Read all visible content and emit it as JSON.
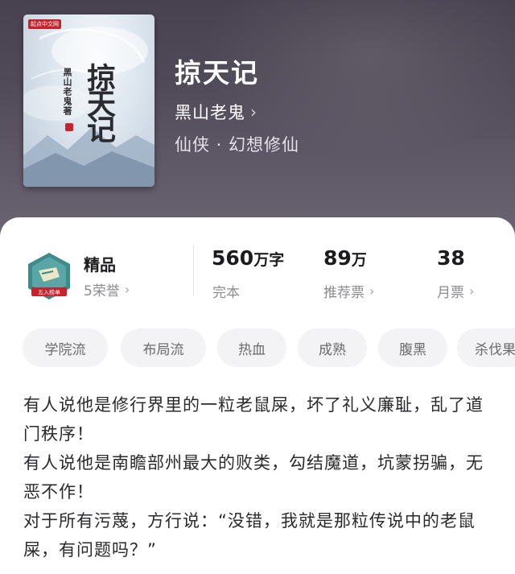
{
  "book": {
    "title": "掠天记",
    "author": "黑山老鬼",
    "genre": "仙侠 · 幻想修仙",
    "cover": {
      "publisher": "起点中文网",
      "title": "掠天记",
      "author": "黑山老鬼著"
    }
  },
  "stats": {
    "quality": {
      "label": "精品",
      "honors": "5荣誉"
    },
    "badge_text": "五入榜单",
    "words": {
      "value": "560",
      "unit": "万字",
      "label": "完本"
    },
    "recommend": {
      "value": "89",
      "unit": "万",
      "label": "推荐票"
    },
    "monthly": {
      "value": "38",
      "label": "月票"
    }
  },
  "tags": [
    "学院流",
    "布局流",
    "热血",
    "成熟",
    "腹黑",
    "杀伐果"
  ],
  "synopsis": [
    "有人说他是修行界里的一粒老鼠屎，坏了礼义廉耻，乱了道门秩序！",
    "有人说他是南瞻部州最大的败类，勾结魔道，坑蒙拐骗，无恶不作！",
    "对于所有污蔑，方行说：“没错，我就是那粒传说中的老鼠屎，有问题吗？”"
  ],
  "colors": {
    "header_bg": "#514a58",
    "badge_teal": "#3d8b8c",
    "badge_red": "#c8232c"
  }
}
